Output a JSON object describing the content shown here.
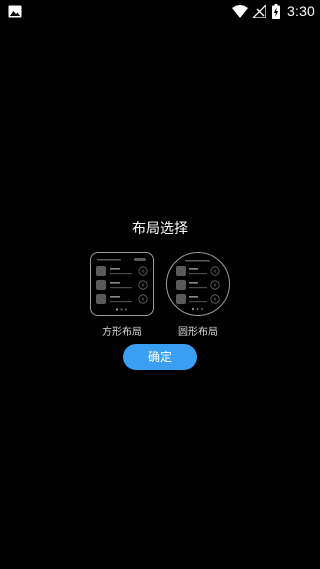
{
  "status_bar": {
    "time": "3:30",
    "icons": [
      "image-notification-icon",
      "wifi-icon",
      "no-sim-signal-icon",
      "battery-charging-icon"
    ]
  },
  "dialog": {
    "title": "布局选择",
    "options": [
      {
        "label": "方形布局",
        "shape": "square"
      },
      {
        "label": "圆形布局",
        "shape": "round"
      }
    ],
    "confirm_label": "确定"
  },
  "colors": {
    "background": "#000000",
    "accent": "#3a9ef2",
    "outline": "#9a9a9a"
  }
}
